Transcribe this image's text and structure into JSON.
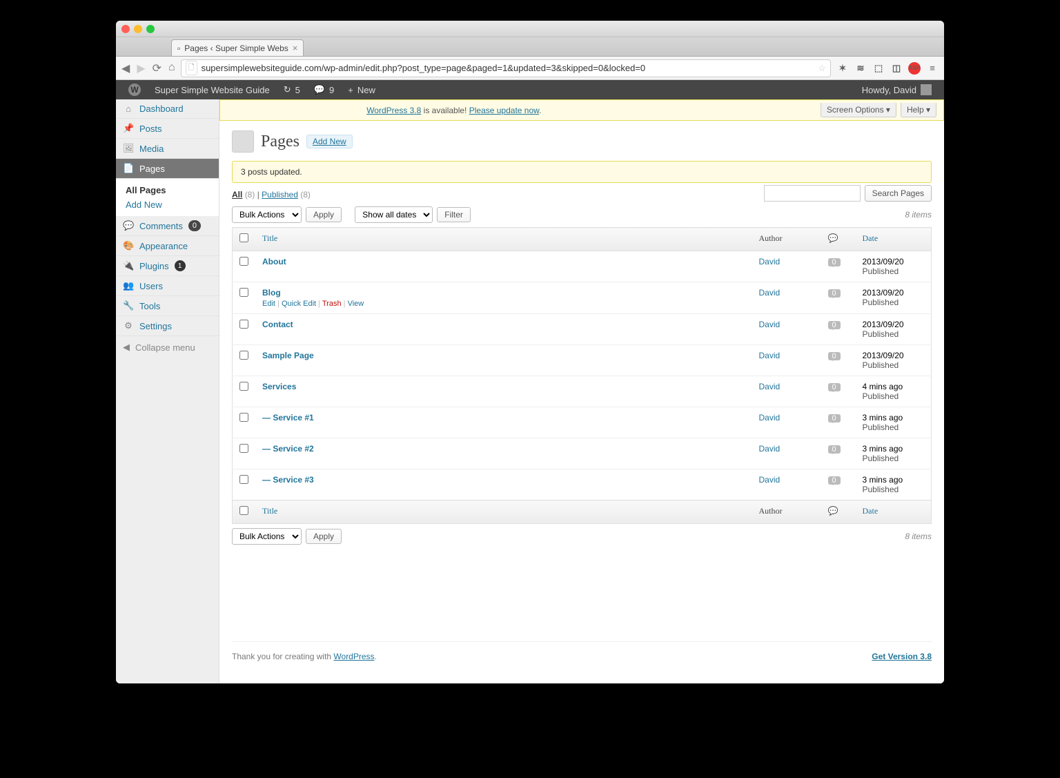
{
  "browser": {
    "tab_title": "Pages ‹ Super Simple Webs",
    "url": "supersimplewebsiteguide.com/wp-admin/edit.php?post_type=page&paged=1&updated=3&skipped=0&locked=0"
  },
  "adminbar": {
    "site_title": "Super Simple Website Guide",
    "updates": "5",
    "comments": "9",
    "new": "New",
    "howdy": "Howdy, David"
  },
  "sidebar": {
    "dashboard": "Dashboard",
    "posts": "Posts",
    "media": "Media",
    "pages": "Pages",
    "all_pages": "All Pages",
    "add_new": "Add New",
    "comments": "Comments",
    "comments_count": "0",
    "appearance": "Appearance",
    "plugins": "Plugins",
    "plugins_count": "1",
    "users": "Users",
    "tools": "Tools",
    "settings": "Settings",
    "collapse": "Collapse menu"
  },
  "nag": {
    "wp_link": "WordPress 3.8",
    "available": " is available! ",
    "update_link": "Please update now",
    "screen_options": "Screen Options",
    "help": "Help"
  },
  "head": {
    "title": "Pages",
    "add_new": "Add New"
  },
  "update_msg": "3 posts updated.",
  "subsub": {
    "all": "All",
    "all_count": "(8)",
    "published": "Published",
    "published_count": "(8)"
  },
  "search_btn": "Search Pages",
  "bulk_label": "Bulk Actions",
  "apply": "Apply",
  "dates_label": "Show all dates",
  "filter": "Filter",
  "items_count": "8 items",
  "cols": {
    "title": "Title",
    "author": "Author",
    "date": "Date"
  },
  "row_actions": {
    "edit": "Edit",
    "quick": "Quick Edit",
    "trash": "Trash",
    "view": "View"
  },
  "rows": [
    {
      "title": "About",
      "author": "David",
      "comments": "0",
      "date": "2013/09/20",
      "status": "Published",
      "actions": false
    },
    {
      "title": "Blog",
      "author": "David",
      "comments": "0",
      "date": "2013/09/20",
      "status": "Published",
      "actions": true
    },
    {
      "title": "Contact",
      "author": "David",
      "comments": "0",
      "date": "2013/09/20",
      "status": "Published",
      "actions": false
    },
    {
      "title": "Sample Page",
      "author": "David",
      "comments": "0",
      "date": "2013/09/20",
      "status": "Published",
      "actions": false
    },
    {
      "title": "Services",
      "author": "David",
      "comments": "0",
      "date": "4 mins ago",
      "status": "Published",
      "actions": false
    },
    {
      "title": "— Service #1",
      "author": "David",
      "comments": "0",
      "date": "3 mins ago",
      "status": "Published",
      "actions": false
    },
    {
      "title": "— Service #2",
      "author": "David",
      "comments": "0",
      "date": "3 mins ago",
      "status": "Published",
      "actions": false
    },
    {
      "title": "— Service #3",
      "author": "David",
      "comments": "0",
      "date": "3 mins ago",
      "status": "Published",
      "actions": false
    }
  ],
  "footer": {
    "thank": "Thank you for creating with ",
    "wp": "WordPress",
    "dot": ".",
    "ver": "Get Version 3.8"
  }
}
